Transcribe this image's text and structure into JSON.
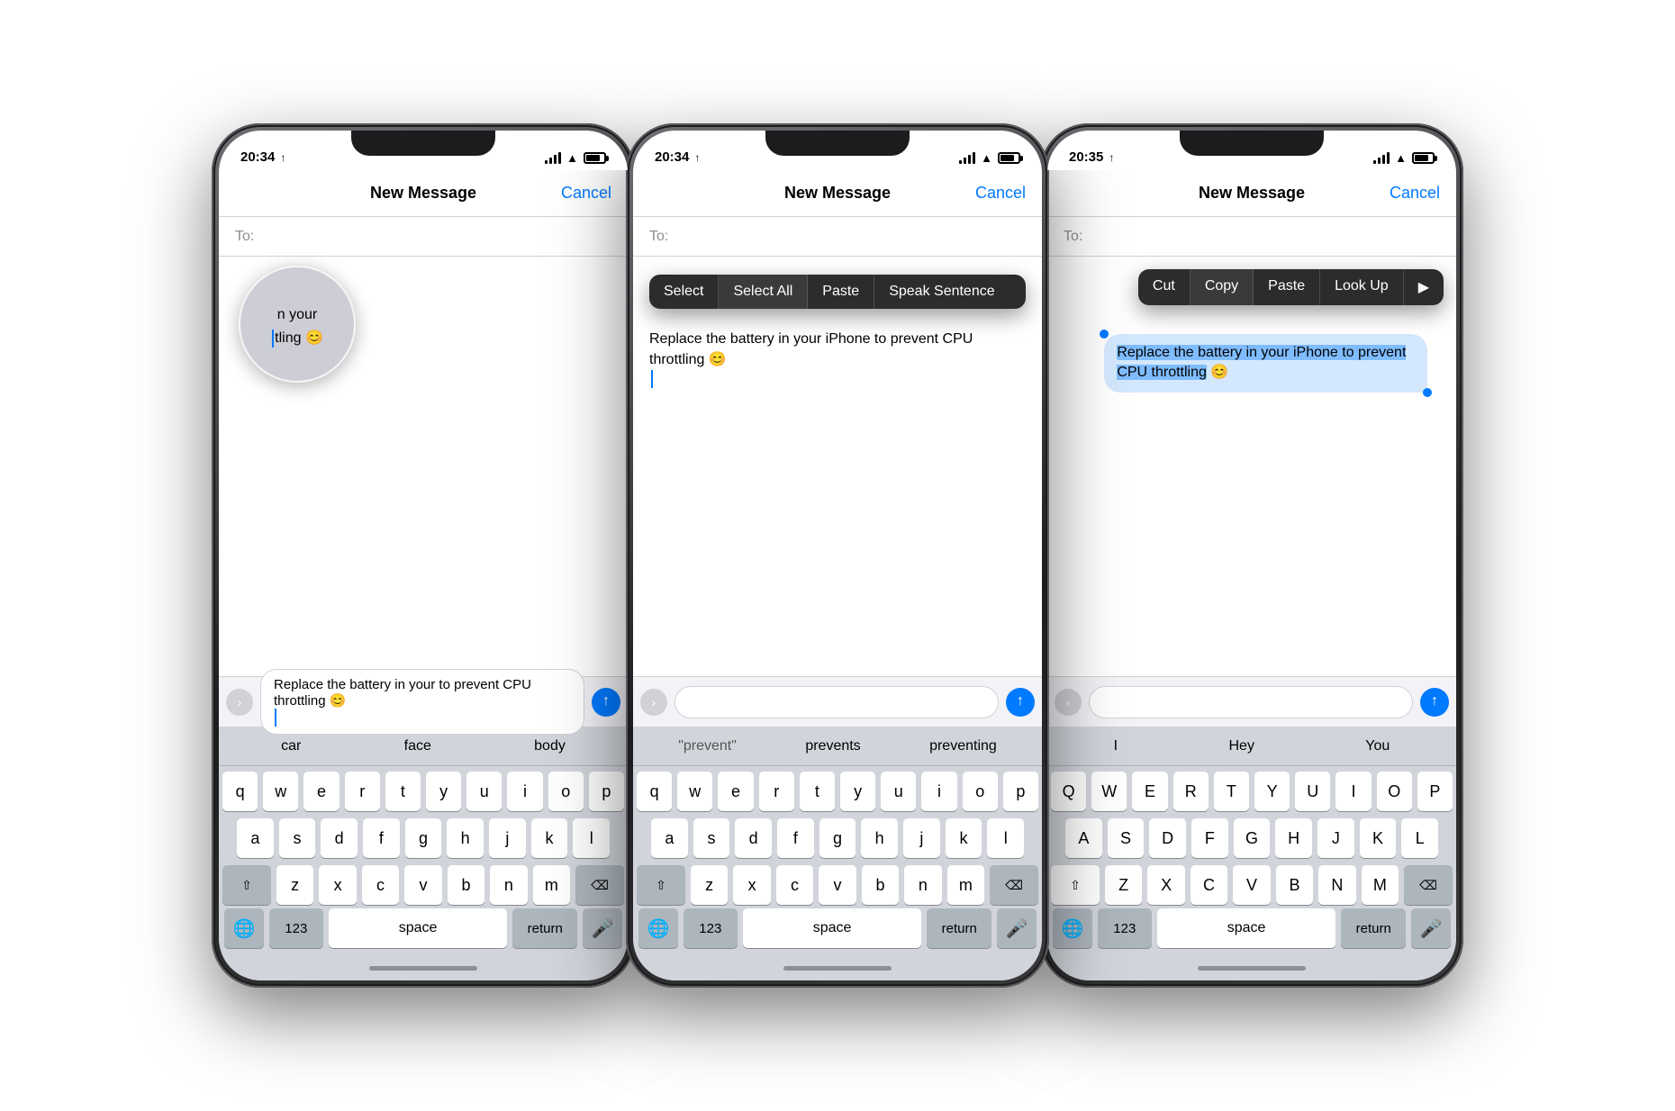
{
  "colors": {
    "accent": "#007aff",
    "background": "#ffffff",
    "keyboard_bg": "#d1d5db",
    "key_bg": "#ffffff",
    "special_key": "#adb5bd",
    "dark_menu": "#2c2c2e",
    "text": "#000000",
    "secondary_text": "#8e8e93",
    "bubble_bg": "#d4e8fd"
  },
  "phone1": {
    "time": "20:34",
    "nav_title": "New Message",
    "nav_cancel": "Cancel",
    "to_label": "To:",
    "input_text": "Replace the battery in your to prevent CPU throttling 😊",
    "magnifier_text": "n your\ntling 😊",
    "suggestions": [
      "car",
      "face",
      "body"
    ],
    "keyboard_rows": [
      [
        "q",
        "w",
        "e",
        "r",
        "t",
        "y",
        "u",
        "i",
        "o",
        "p"
      ],
      [
        "a",
        "s",
        "d",
        "f",
        "g",
        "h",
        "j",
        "k",
        "l"
      ],
      [
        "z",
        "x",
        "c",
        "v",
        "b",
        "n",
        "m"
      ]
    ],
    "bottom_keys": [
      "123",
      "space",
      "return"
    ]
  },
  "phone2": {
    "time": "20:34",
    "nav_title": "New Message",
    "nav_cancel": "Cancel",
    "to_label": "To:",
    "message_text": "Replace the battery in your iPhone to prevent CPU throttling 😊",
    "context_menu": [
      "Select",
      "Select All",
      "Paste",
      "Speak Sentence"
    ],
    "suggestions": [
      "\"prevent\"",
      "prevents",
      "preventing"
    ],
    "keyboard_rows": [
      [
        "q",
        "w",
        "e",
        "r",
        "t",
        "y",
        "u",
        "i",
        "o",
        "p"
      ],
      [
        "a",
        "s",
        "d",
        "f",
        "g",
        "h",
        "j",
        "k",
        "l"
      ],
      [
        "z",
        "x",
        "c",
        "v",
        "b",
        "n",
        "m"
      ]
    ]
  },
  "phone3": {
    "time": "20:35",
    "nav_title": "New Message",
    "nav_cancel": "Cancel",
    "to_label": "To:",
    "message_text": "Replace the battery in your iPhone to prevent CPU throttling 😊",
    "context_menu": [
      "Cut",
      "Copy",
      "Paste",
      "Look Up",
      "▶"
    ],
    "suggestions": [
      "I",
      "Hey",
      "You"
    ],
    "keyboard_rows_upper": [
      [
        "Q",
        "W",
        "E",
        "R",
        "T",
        "Y",
        "U",
        "I",
        "O",
        "P"
      ],
      [
        "A",
        "S",
        "D",
        "F",
        "G",
        "H",
        "J",
        "K",
        "L"
      ],
      [
        "Z",
        "X",
        "C",
        "V",
        "B",
        "N",
        "M"
      ]
    ]
  }
}
